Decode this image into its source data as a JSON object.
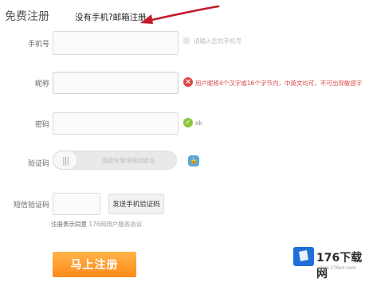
{
  "header": {
    "title": "免费注册",
    "switch_link": "没有手机?邮箱注册"
  },
  "form": {
    "phone": {
      "label": "手机号",
      "value": "",
      "hint": "请输入您的手机号"
    },
    "nickname": {
      "label": "昵称",
      "value": "",
      "hint": "用户昵称4个汉字或16个字节内，中英文均可，不可出现敏感字"
    },
    "password": {
      "label": "密码",
      "value": "",
      "hint": "ok"
    },
    "captcha": {
      "label": "验证码",
      "slider_text": "请按住滑块拖动验证"
    },
    "sms": {
      "label": "短信验证码",
      "value": "",
      "send_button": "发送手机验证码"
    },
    "agreement": {
      "prefix": "注册表示同意",
      "link": "176网用户服务协议"
    },
    "submit_label": "马上注册"
  },
  "watermark": {
    "text": "176下载网",
    "sub": "www.176xz.com"
  },
  "colors": {
    "submit_orange": "#ff9a2a",
    "error_red": "#d94a4a",
    "ok_green": "#8cc63f",
    "lock_blue": "#5aa7d9",
    "arrow_red": "#c21b2a"
  }
}
